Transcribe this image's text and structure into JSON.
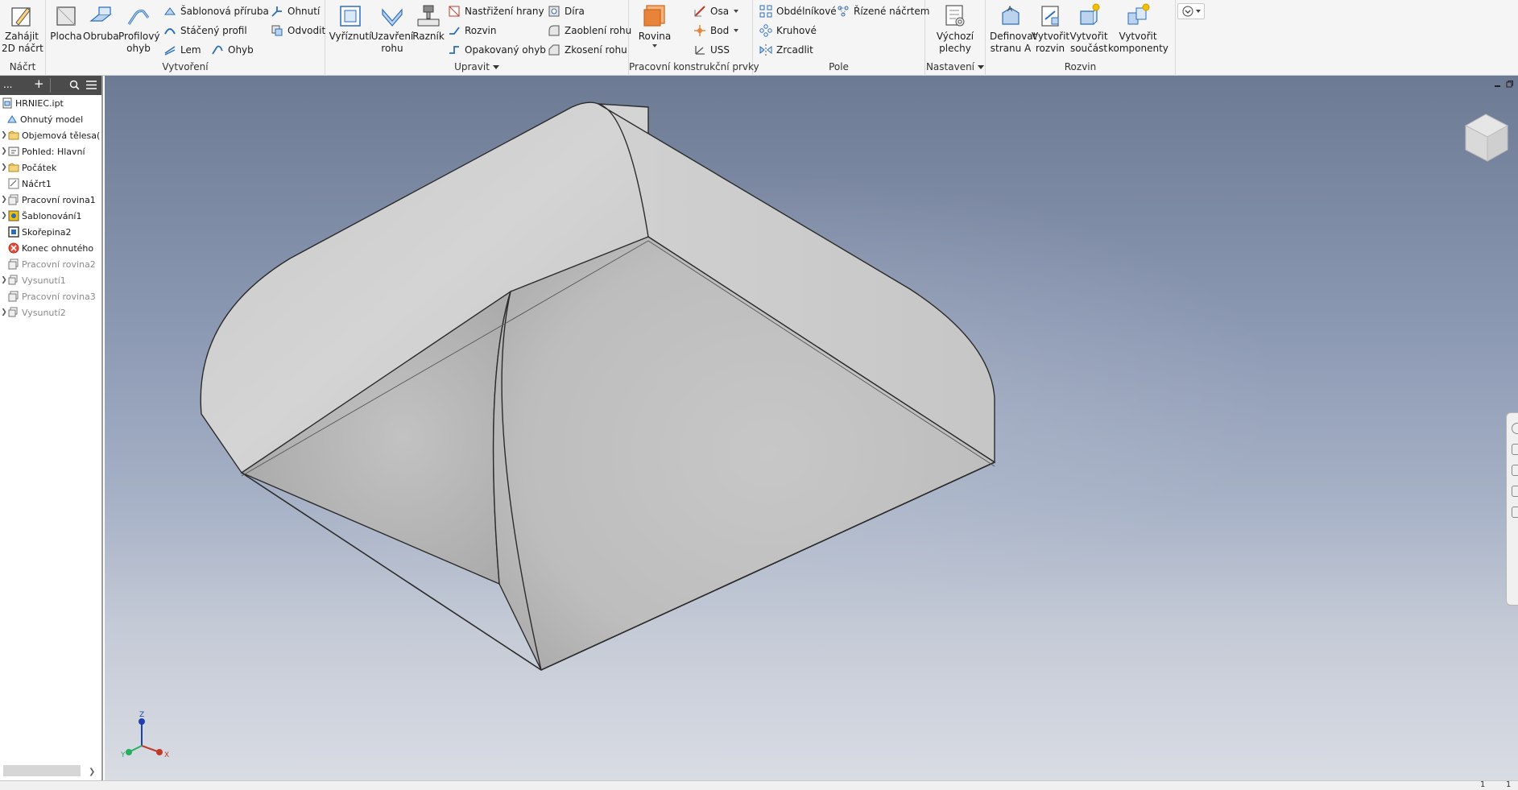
{
  "ribbon": {
    "nacrt": {
      "title": "Náčrt",
      "start_2d": [
        "Zahájit",
        "2D náčrt"
      ]
    },
    "vytvoreni": {
      "title": "Vytvoření",
      "plocha": "Plocha",
      "obruba": "Obruba",
      "profilovy_ohyb": [
        "Profilový",
        "ohyb"
      ],
      "sablonova_priruba": "Šablonová příruba",
      "staceny_profil": "Stáčený profil",
      "lem": "Lem",
      "ohyb": "Ohyb",
      "ohnuti": "Ohnutí",
      "odvodit": "Odvodit"
    },
    "upravit": {
      "title": "Upravit",
      "vyriznuti": "Vyříznutí",
      "uzavreni_rohu": [
        "Uzavření",
        "rohu"
      ],
      "raznik": "Razník",
      "nastrizeni_hrany": "Nastřižení hrany",
      "rozvin": "Rozvin",
      "opakovany_ohyb": "Opakovaný ohyb",
      "dira": "Díra",
      "zaobleni_rohu": "Zaoblení rohu",
      "zkoseni_rohu": "Zkosení rohu"
    },
    "pracovni": {
      "title": "Pracovní konstrukční prvky",
      "rovina": "Rovina",
      "osa": "Osa",
      "bod": "Bod",
      "uss": "USS"
    },
    "pole": {
      "title": "Pole",
      "obdelnikove": "Obdélníkové",
      "kruhove": "Kruhové",
      "zrcadlit": "Zrcadlit",
      "rizene_nacrtem": "Řízené náčrtem"
    },
    "nastaveni": {
      "title": "Nastavení",
      "vychozi_plechy": [
        "Výchozí",
        "plechy"
      ]
    },
    "rozvin": {
      "title": "Rozvin",
      "definovat_stranu": [
        "Definovat",
        "stranu A"
      ],
      "vytvorit_rozvin": [
        "Vytvořit",
        "rozvin"
      ],
      "vytvorit_soucast": [
        "Vytvořit",
        "součást"
      ],
      "vytvorit_komponenty": [
        "Vytvořit",
        "komponenty"
      ]
    }
  },
  "browser": {
    "toolbar_ellipsis": "...",
    "toolbar_add": "+",
    "items": [
      {
        "label": "HRNIEC.ipt",
        "expandable": false,
        "dim": false,
        "icon": "part-file-icon"
      },
      {
        "label": "Ohnutý model",
        "expandable": false,
        "dim": false,
        "icon": "sheet-metal-model-icon"
      },
      {
        "label": "Objemová tělesa(",
        "expandable": true,
        "dim": false,
        "icon": "solid-bodies-folder-icon"
      },
      {
        "label": "Pohled: Hlavní",
        "expandable": true,
        "dim": false,
        "icon": "view-icon"
      },
      {
        "label": "Počátek",
        "expandable": true,
        "dim": false,
        "icon": "origin-folder-icon"
      },
      {
        "label": "Náčrt1",
        "expandable": false,
        "dim": false,
        "icon": "sketch-icon"
      },
      {
        "label": "Pracovní rovina1",
        "expandable": true,
        "dim": false,
        "icon": "work-plane-icon"
      },
      {
        "label": "Šablonování1",
        "expandable": true,
        "dim": false,
        "icon": "loft-icon"
      },
      {
        "label": "Skořepina2",
        "expandable": false,
        "dim": false,
        "icon": "shell-icon"
      },
      {
        "label": "Konec ohnutého",
        "expandable": false,
        "dim": false,
        "icon": "end-of-folded-icon"
      },
      {
        "label": "Pracovní rovina2",
        "expandable": false,
        "dim": true,
        "icon": "work-plane-icon"
      },
      {
        "label": "Vysunutí1",
        "expandable": true,
        "dim": true,
        "icon": "extrude-icon"
      },
      {
        "label": "Pracovní rovina3",
        "expandable": false,
        "dim": true,
        "icon": "work-plane-icon"
      },
      {
        "label": "Vysunutí2",
        "expandable": true,
        "dim": true,
        "icon": "extrude-icon"
      }
    ]
  },
  "viewport": {
    "triad": {
      "x": "X",
      "y": "Y",
      "z": "Z"
    }
  },
  "status": {
    "page_a": "1",
    "page_b": "1"
  },
  "colors": {
    "ribbon_bg": "#f5f5f5",
    "browser_header": "#4b4b4b",
    "accent_blue": "#2a6ebb",
    "accent_orange": "#e8833a"
  }
}
